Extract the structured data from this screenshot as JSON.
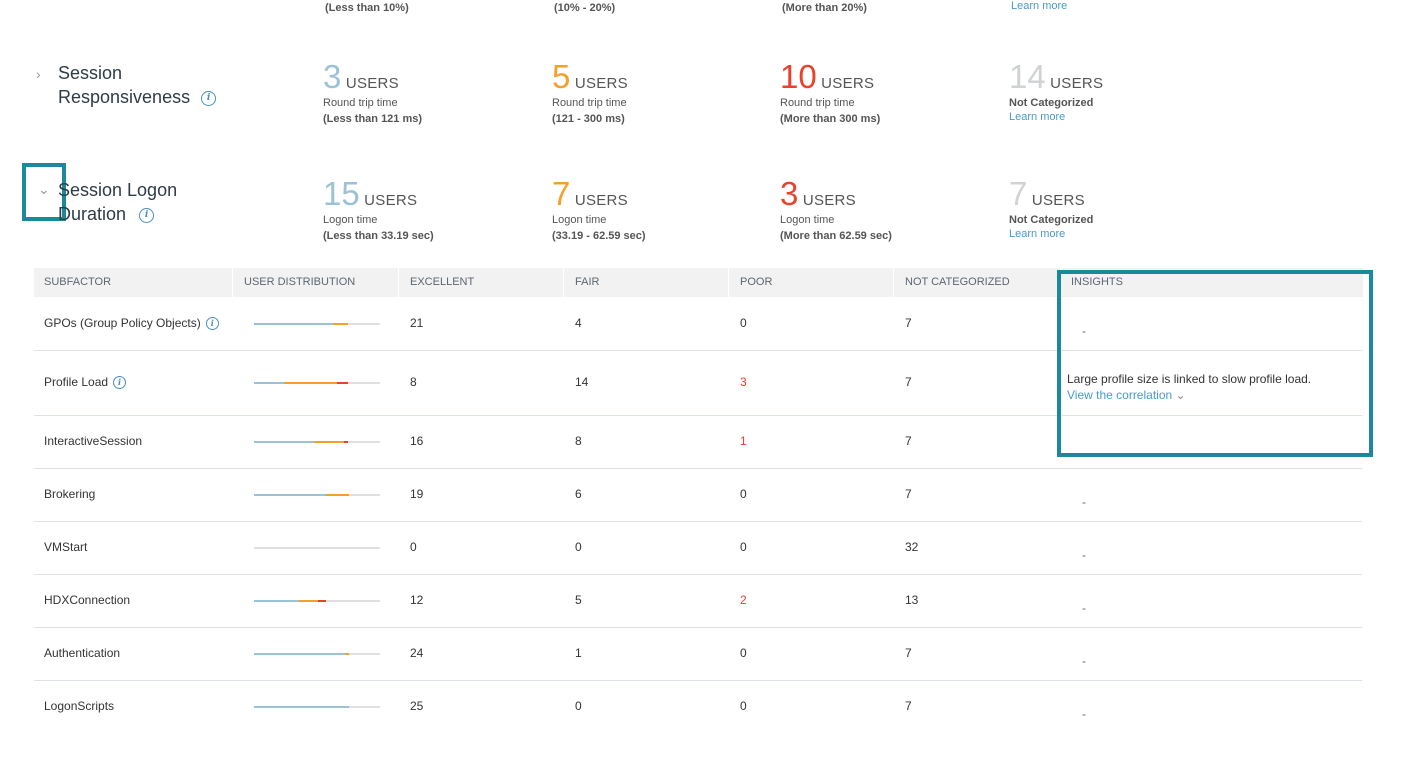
{
  "top_partial": {
    "col1": "(Less than 10%)",
    "col2": "(10% - 20%)",
    "col3": "(More than 20%)",
    "col4": "Learn more"
  },
  "responsiveness": {
    "title_line1": "Session",
    "title_line2": "Responsiveness",
    "excellent": {
      "count": "3",
      "unit": "USERS",
      "label": "Round trip time",
      "range": "(Less than 121 ms)"
    },
    "fair": {
      "count": "5",
      "unit": "USERS",
      "label": "Round trip time",
      "range": "(121 - 300 ms)"
    },
    "poor": {
      "count": "10",
      "unit": "USERS",
      "label": "Round trip time",
      "range": "(More than 300 ms)"
    },
    "na": {
      "count": "14",
      "unit": "USERS",
      "label": "Not Categorized",
      "link": "Learn more"
    }
  },
  "logon": {
    "title_line1": "Session Logon",
    "title_line2": "Duration",
    "excellent": {
      "count": "15",
      "unit": "USERS",
      "label": "Logon time",
      "range": "(Less than 33.19 sec)"
    },
    "fair": {
      "count": "7",
      "unit": "USERS",
      "label": "Logon time",
      "range": "(33.19 - 62.59 sec)"
    },
    "poor": {
      "count": "3",
      "unit": "USERS",
      "label": "Logon time",
      "range": "(More than 62.59 sec)"
    },
    "na": {
      "count": "7",
      "unit": "USERS",
      "label": "Not Categorized",
      "link": "Learn more"
    }
  },
  "table": {
    "headers": [
      "SUBFACTOR",
      "USER DISTRIBUTION",
      "EXCELLENT",
      "FAIR",
      "POOR",
      "NOT CATEGORIZED",
      "INSIGHTS"
    ],
    "rows": [
      {
        "name": "GPOs (Group Policy Objects)",
        "info": true,
        "excellent": "21",
        "fair": "4",
        "poor": "0",
        "na": "7",
        "insight": "-",
        "dist": [
          0.21,
          0.04,
          0.0
        ]
      },
      {
        "name": "Profile Load",
        "info": true,
        "excellent": "8",
        "fair": "14",
        "poor": "3",
        "na": "7",
        "insight": "Large profile size is linked to slow profile load.",
        "insight_link": "View the correlation",
        "dist": [
          0.08,
          0.14,
          0.03
        ]
      },
      {
        "name": "InteractiveSession",
        "info": false,
        "excellent": "16",
        "fair": "8",
        "poor": "1",
        "na": "7",
        "insight": "",
        "dist": [
          0.16,
          0.08,
          0.01
        ]
      },
      {
        "name": "Brokering",
        "info": false,
        "excellent": "19",
        "fair": "6",
        "poor": "0",
        "na": "7",
        "insight": "-",
        "dist": [
          0.19,
          0.06,
          0.0
        ]
      },
      {
        "name": "VMStart",
        "info": false,
        "excellent": "0",
        "fair": "0",
        "poor": "0",
        "na": "32",
        "insight": "-",
        "dist": [
          0.0,
          0.0,
          0.0
        ]
      },
      {
        "name": "HDXConnection",
        "info": false,
        "excellent": "12",
        "fair": "5",
        "poor": "2",
        "na": "13",
        "insight": "-",
        "dist": [
          0.12,
          0.05,
          0.02
        ]
      },
      {
        "name": "Authentication",
        "info": false,
        "excellent": "24",
        "fair": "1",
        "poor": "0",
        "na": "7",
        "insight": "-",
        "dist": [
          0.24,
          0.01,
          0.0
        ]
      },
      {
        "name": "LogonScripts",
        "info": false,
        "excellent": "25",
        "fair": "0",
        "poor": "0",
        "na": "7",
        "insight": "-",
        "dist": [
          0.25,
          0.0,
          0.0
        ]
      }
    ]
  },
  "colors": {
    "excellent": "#9cc2d6",
    "fair": "#f4a12b",
    "poor": "#e8412c",
    "highlight": "#1a8a9a",
    "link": "#4a9bc9"
  },
  "icons": {
    "collapsed": "chevron-right-icon",
    "expanded": "chevron-down-icon",
    "info": "info-icon"
  }
}
